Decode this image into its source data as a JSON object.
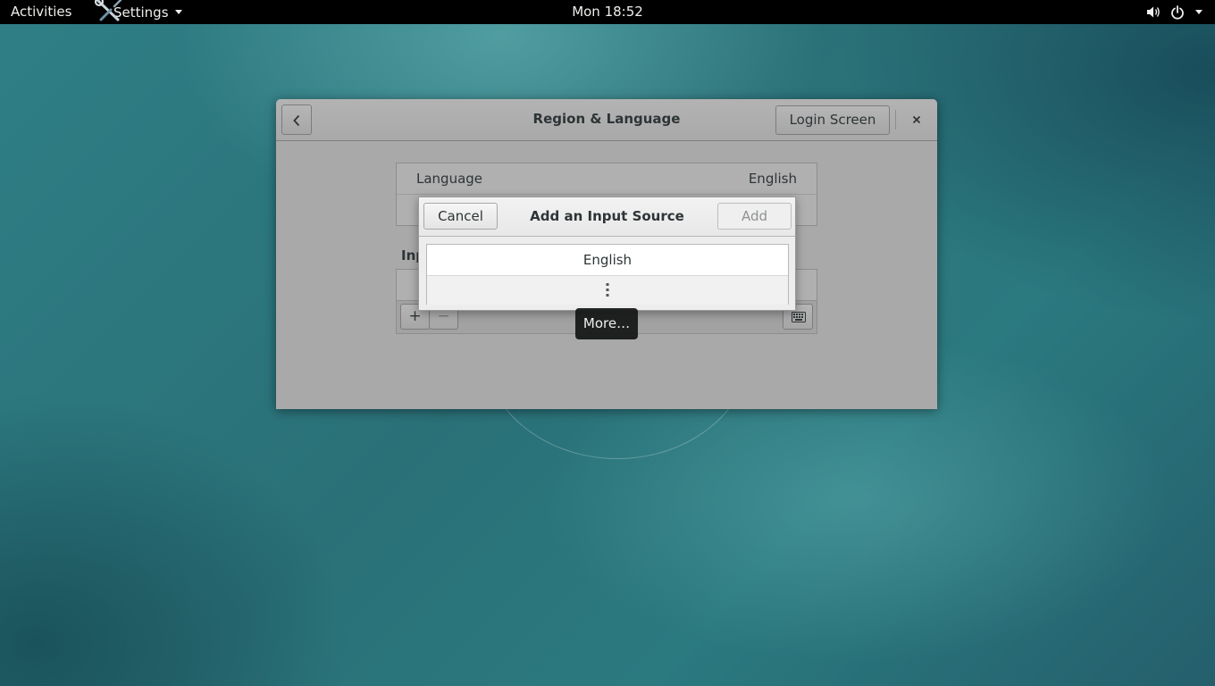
{
  "topbar": {
    "activities_label": "Activities",
    "app_menu_label": "Settings",
    "clock": "Mon 18:52",
    "icons": [
      "settings-app-icon",
      "volume-icon",
      "power-icon",
      "chevron-down-icon"
    ]
  },
  "window": {
    "title": "Region & Language",
    "login_screen_label": "Login Screen",
    "close_icon": "close-icon",
    "back_icon": "go-back-icon"
  },
  "region": {
    "rows": [
      {
        "label": "Language",
        "value": "English"
      },
      {
        "label": "",
        "value": ""
      }
    ]
  },
  "input_sources": {
    "heading": "Inp",
    "add_label": "+",
    "remove_label": "−"
  },
  "dialog": {
    "title": "Add an Input Source",
    "cancel_label": "Cancel",
    "add_label": "Add",
    "add_enabled": false,
    "items": [
      {
        "label": "English"
      }
    ],
    "more_icon": "view-more-icon"
  },
  "tooltip": {
    "text": "More…"
  },
  "colors": {
    "topbar": "#000000",
    "desktop": "#2b7a80",
    "window_dimmed": "#a9a9a9",
    "dialog_bg": "#ededed"
  }
}
